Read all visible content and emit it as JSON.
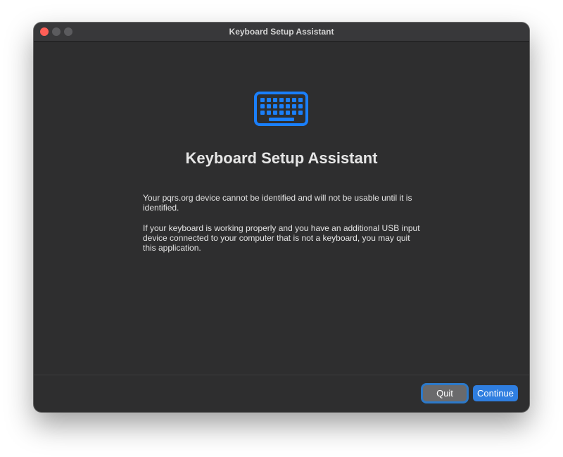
{
  "window": {
    "title": "Keyboard Setup Assistant"
  },
  "icon": {
    "name": "keyboard-icon",
    "color": "#1a7ffb"
  },
  "content": {
    "heading": "Keyboard Setup Assistant",
    "paragraph1": "Your pqrs.org device cannot be identified and will not be usable until it is identified.",
    "paragraph2": "If your keyboard is working properly and you have an additional USB input device connected to your computer that is not a keyboard, you may quit this application."
  },
  "buttons": {
    "quit": "Quit",
    "continue": "Continue"
  },
  "colors": {
    "accent": "#2f7ee0",
    "close": "#ff5f57"
  }
}
